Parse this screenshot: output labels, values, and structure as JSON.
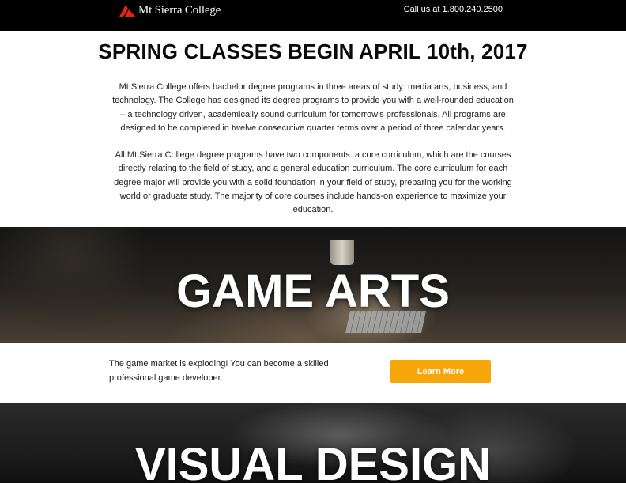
{
  "header": {
    "logo_text": "Mt Sierra College",
    "phone": "Call us at 1.800.240.2500"
  },
  "intro": {
    "title": "SPRING CLASSES BEGIN APRIL 10th, 2017",
    "paragraph_1": "Mt Sierra College offers bachelor degree programs in three areas of study: media arts, business, and technology. The College has designed its degree programs to provide you with a well-rounded education – a technology driven, academically sound curriculum for tomorrow's professionals. All programs are designed to be completed in twelve consecutive quarter terms over a period of three calendar years.",
    "paragraph_2": "All Mt Sierra College degree programs have two components: a core curriculum, which are the courses directly relating to the field of study, and a general education curriculum. The core curriculum for each degree major will provide you with a solid foundation in your field of study, preparing you for the working world or graduate study. The majority of core courses include hands-on experience to maximize your education."
  },
  "programs": [
    {
      "title": "GAME ARTS",
      "description": "The game market is exploding! You can become a skilled professional game developer.",
      "button_label": "Learn More"
    },
    {
      "title": "VISUAL DESIGN"
    }
  ],
  "colors": {
    "header_bg": "#000000",
    "logo_red": "#e2231a",
    "button_bg": "#f7a60a",
    "button_text": "#ffffff"
  }
}
